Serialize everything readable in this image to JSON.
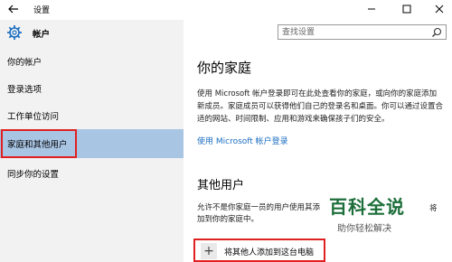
{
  "window": {
    "title": "设置"
  },
  "sidebar": {
    "header": "帐户",
    "items": [
      {
        "label": "你的帐户"
      },
      {
        "label": "登录选项"
      },
      {
        "label": "工作单位访问"
      },
      {
        "label": "家庭和其他用户"
      },
      {
        "label": "同步你的设置"
      }
    ]
  },
  "search": {
    "placeholder": "查找设置"
  },
  "family": {
    "heading": "你的家庭",
    "description": "使用 Microsoft 帐户登录即可在此处查看你的家庭，或向你的家庭添加新成员。家庭成员可以获得他们自己的登录名和桌面。你可以通过设置合适的网站、时间限制、应用和游戏来确保孩子们的安全。",
    "link": "使用 Microsoft 帐户登录"
  },
  "other_users": {
    "heading": "其他用户",
    "description": "允许不是你家庭一员的用户使用其添加到你的家庭中。",
    "description_tail": "将",
    "add_button": "将其他人添加到这台电脑"
  },
  "watermark": {
    "title": "百科全说",
    "subtitle": "助你轻松解决"
  },
  "colors": {
    "accent": "#1b6ec2",
    "highlight": "#a9c5e4",
    "callout": "#e02020"
  }
}
